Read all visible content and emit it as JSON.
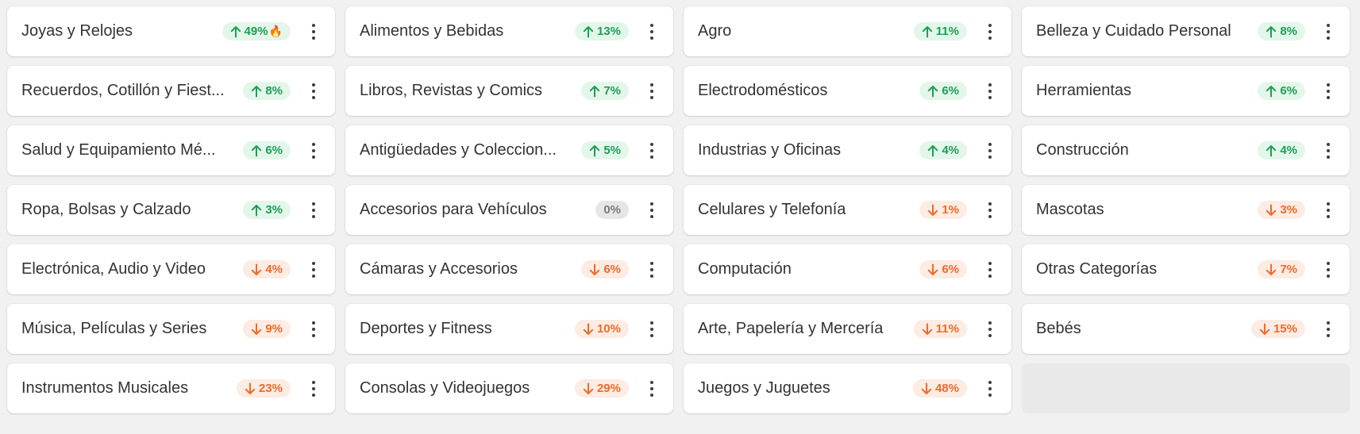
{
  "colors": {
    "up_text": "#1e9e57",
    "up_bg": "#e3f6ea",
    "down_text": "#f06a2a",
    "down_bg": "#fdece3",
    "flat_text": "#7a7a7a",
    "flat_bg": "#e6e6e6"
  },
  "icons": {
    "up": "arrow-up-icon",
    "down": "arrow-down-icon",
    "more": "more-vertical-icon",
    "hot": "fire-icon"
  },
  "cards": [
    {
      "label": "Joyas y Relojes",
      "change": "49%",
      "trend": "up",
      "hot": "🔥"
    },
    {
      "label": "Alimentos y Bebidas",
      "change": "13%",
      "trend": "up"
    },
    {
      "label": "Agro",
      "change": "11%",
      "trend": "up"
    },
    {
      "label": "Belleza y Cuidado Personal",
      "change": "8%",
      "trend": "up"
    },
    {
      "label": "Recuerdos, Cotillón y Fiest...",
      "change": "8%",
      "trend": "up"
    },
    {
      "label": "Libros, Revistas y Comics",
      "change": "7%",
      "trend": "up"
    },
    {
      "label": "Electrodomésticos",
      "change": "6%",
      "trend": "up"
    },
    {
      "label": "Herramientas",
      "change": "6%",
      "trend": "up"
    },
    {
      "label": "Salud y Equipamiento Mé...",
      "change": "6%",
      "trend": "up"
    },
    {
      "label": "Antigüedades y Coleccion...",
      "change": "5%",
      "trend": "up"
    },
    {
      "label": "Industrias y Oficinas",
      "change": "4%",
      "trend": "up"
    },
    {
      "label": "Construcción",
      "change": "4%",
      "trend": "up"
    },
    {
      "label": "Ropa, Bolsas y Calzado",
      "change": "3%",
      "trend": "up"
    },
    {
      "label": "Accesorios para Vehículos",
      "change": "0%",
      "trend": "flat"
    },
    {
      "label": "Celulares y Telefonía",
      "change": "1%",
      "trend": "down"
    },
    {
      "label": "Mascotas",
      "change": "3%",
      "trend": "down"
    },
    {
      "label": "Electrónica, Audio y Video",
      "change": "4%",
      "trend": "down"
    },
    {
      "label": "Cámaras y Accesorios",
      "change": "6%",
      "trend": "down"
    },
    {
      "label": "Computación",
      "change": "6%",
      "trend": "down"
    },
    {
      "label": "Otras Categorías",
      "change": "7%",
      "trend": "down"
    },
    {
      "label": "Música, Películas y Series",
      "change": "9%",
      "trend": "down"
    },
    {
      "label": "Deportes y Fitness",
      "change": "10%",
      "trend": "down"
    },
    {
      "label": "Arte, Papelería y Mercería",
      "change": "11%",
      "trend": "down"
    },
    {
      "label": "Bebés",
      "change": "15%",
      "trend": "down"
    },
    {
      "label": "Instrumentos Musicales",
      "change": "23%",
      "trend": "down"
    },
    {
      "label": "Consolas y Videojuegos",
      "change": "29%",
      "trend": "down"
    },
    {
      "label": "Juegos y Juguetes",
      "change": "48%",
      "trend": "down"
    }
  ]
}
